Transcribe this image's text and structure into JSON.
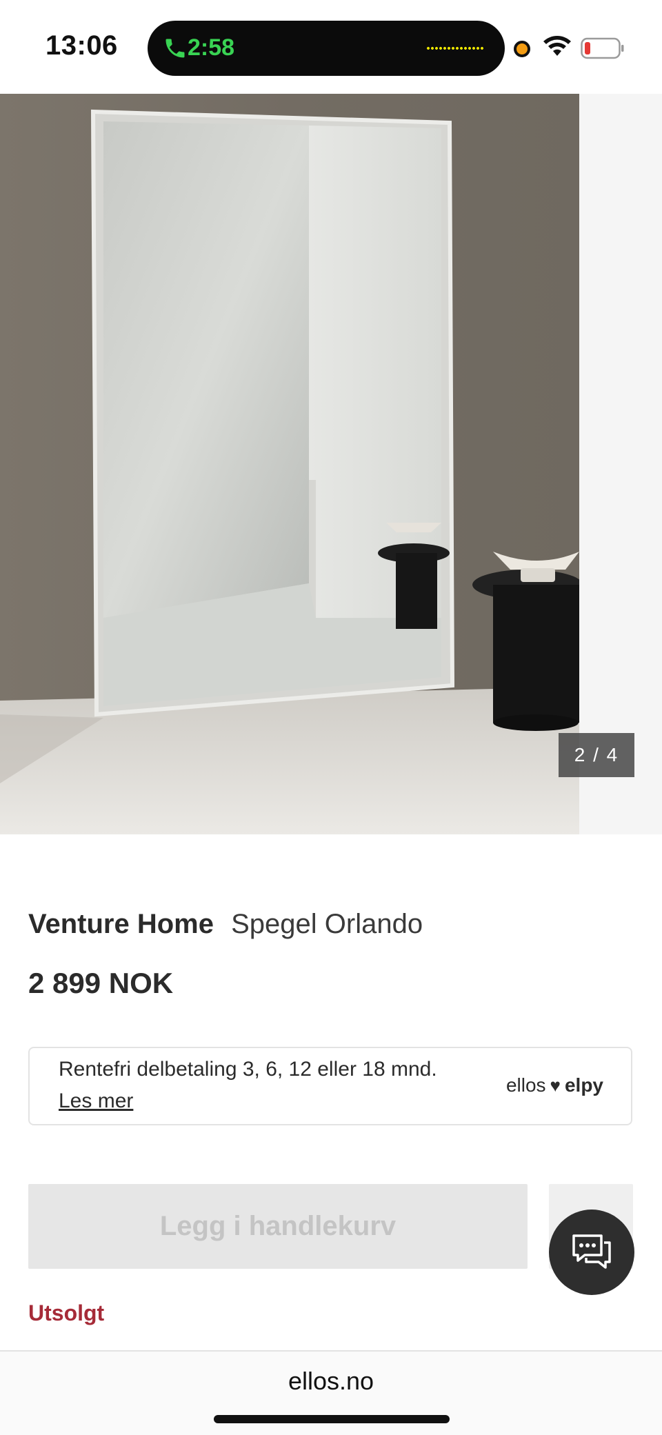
{
  "status_bar": {
    "time": "13:06",
    "call_timer": "2:58",
    "icons": [
      "phone-icon",
      "recording-dot-icon",
      "wifi-icon",
      "battery-low-icon"
    ]
  },
  "gallery": {
    "counter": "2 / 4",
    "image": "full-length-mirror-product-photo"
  },
  "product": {
    "brand": "Venture Home",
    "name": "Spegel Orlando",
    "price": "2 899 NOK"
  },
  "payment": {
    "text": "Rentefri delbetaling 3, 6, 12 eller 18 mnd.",
    "link": "Les mer",
    "logo_left": "ellos",
    "logo_right": "elpy"
  },
  "actions": {
    "add_to_cart": "Legg i handlekurv",
    "status": "Utsolgt"
  },
  "browser": {
    "url": "ellos.no"
  },
  "colors": {
    "sold_out": "#a62b38",
    "call_green": "#39d353",
    "button_disabled_bg": "#e6e6e6"
  }
}
